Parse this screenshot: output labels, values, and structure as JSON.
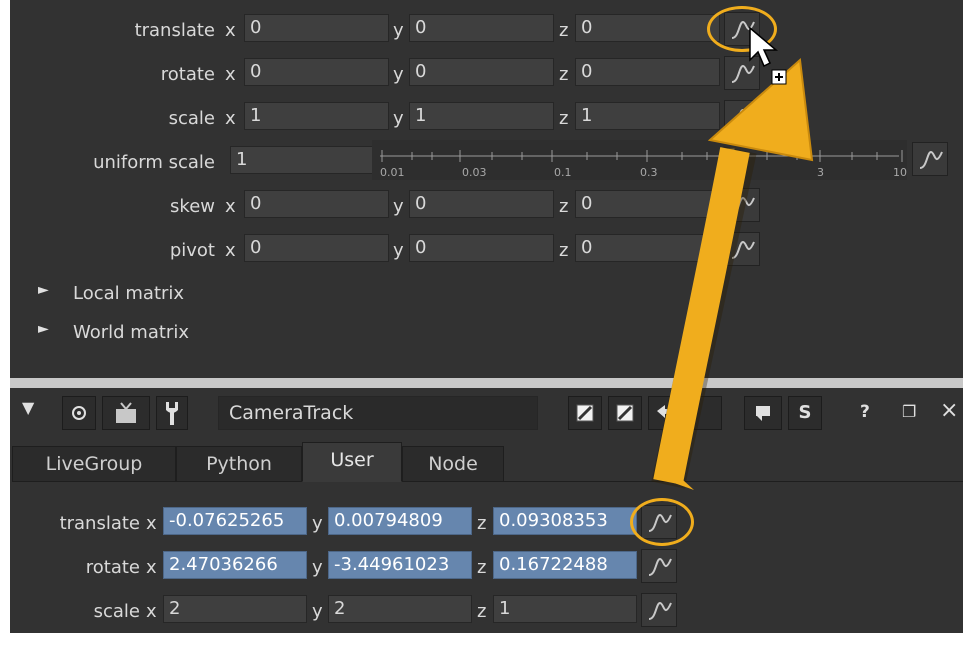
{
  "upper": {
    "rows": [
      {
        "label": "translate",
        "x": "0",
        "y": "0",
        "z": "0"
      },
      {
        "label": "rotate",
        "x": "0",
        "y": "0",
        "z": "0"
      },
      {
        "label": "scale",
        "x": "1",
        "y": "1",
        "z": "1"
      },
      {
        "label": "skew",
        "x": "0",
        "y": "0",
        "z": "0"
      },
      {
        "label": "pivot",
        "x": "0",
        "y": "0",
        "z": "0"
      }
    ],
    "axes": {
      "x": "x",
      "y": "y",
      "z": "z"
    },
    "uniform_scale": {
      "label": "uniform scale",
      "value": "1",
      "ticks": [
        "0.01",
        "0.03",
        "0.1",
        "0.3",
        "1",
        "3",
        "10"
      ]
    },
    "local_matrix": "Local matrix",
    "world_matrix": "World matrix"
  },
  "node": {
    "name": "CameraTrack",
    "toolbar": {
      "s_label": "S",
      "help_label": "?",
      "close_label": "×"
    },
    "tabs": [
      "LiveGroup",
      "Python",
      "User",
      "Node"
    ],
    "active_tab": "User",
    "rows": [
      {
        "label": "translate",
        "x": "-0.07625265",
        "y": "0.00794809",
        "z": "0.09308353"
      },
      {
        "label": "rotate",
        "x": "2.47036266",
        "y": "-3.44961023",
        "z": "0.16722488"
      },
      {
        "label": "scale",
        "x": "2",
        "y": "2",
        "z": "1"
      }
    ]
  },
  "colors": {
    "panel": "#323232",
    "highlight": "#f0ad1d",
    "selected_field": "#6686ae"
  }
}
